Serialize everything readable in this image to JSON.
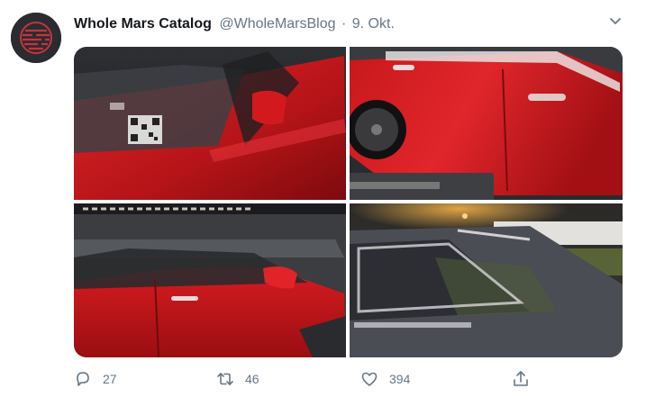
{
  "tweet": {
    "display_name": "Whole Mars Catalog",
    "handle": "@WholeMarsBlog",
    "separator": "·",
    "date": "9. Okt."
  },
  "photos": [
    {
      "subject": "red car interior with QR code on dashboard"
    },
    {
      "subject": "red car side with dark wheel on car transporter"
    },
    {
      "subject": "red car side with mirror on car transporter"
    },
    {
      "subject": "grey car rear window at night"
    }
  ],
  "actions": {
    "reply_count": "27",
    "retweet_count": "46",
    "like_count": "394"
  },
  "icons": {
    "avatar": "avatar-logo-icon",
    "menu": "chevron-down-icon",
    "reply": "reply-icon",
    "retweet": "retweet-icon",
    "like": "heart-icon",
    "share": "share-icon"
  },
  "colors": {
    "text_primary": "#14171a",
    "text_secondary": "#657786",
    "avatar_bg": "#2a2c31",
    "avatar_accent": "#c8333a",
    "car_red": "#c8181c",
    "car_grey": "#4a4d54"
  }
}
